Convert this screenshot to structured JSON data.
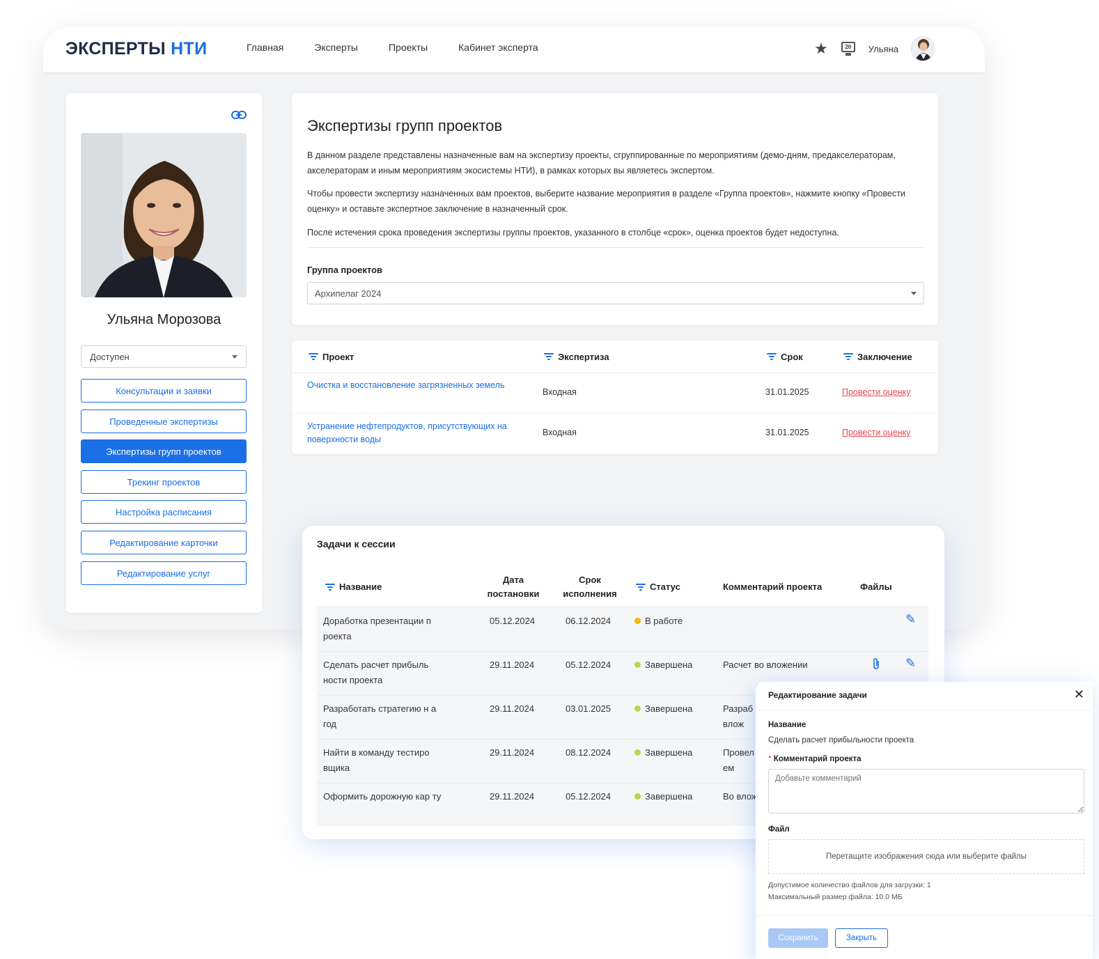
{
  "header": {
    "logo_part1": "ЭКСПЕРТЫ",
    "logo_part2": "НТИ",
    "nav": [
      "Главная",
      "Эксперты",
      "Проекты",
      "Кабинет эксперта"
    ],
    "notification_count": "20",
    "user_name": "Ульяна"
  },
  "profile": {
    "name": "Ульяна Морозова",
    "status": "Доступен",
    "menu": [
      "Консультации и заявки",
      "Проведенные экспертизы",
      "Экспертизы групп проектов",
      "Трекинг проектов",
      "Настройка расписания",
      "Редактирование карточки",
      "Редактирование услуг"
    ],
    "active_menu_index": 2
  },
  "info": {
    "title": "Экспертизы групп проектов",
    "p1": "В данном разделе представлены назначенные вам на экспертизу проекты, сгруппированные по мероприятиям (демо-дням, предакселераторам, акселераторам и иным мероприятиям экосистемы НТИ), в рамках которых вы являетесь экспертом.",
    "p2": "Чтобы провести экспертизу назначенных вам проектов, выберите название мероприятия в разделе «Группа проектов», нажмите кнопку «Провести оценку» и оставьте экспертное заключение в назначенный срок.",
    "p3": "После истечения срока проведения экспертизы группы проектов, указанного в столбце «срок», оценка проектов будет недоступна.",
    "group_label": "Группа проектов",
    "group_value": "Архипелаг 2024"
  },
  "projects": {
    "headers": [
      "Проект",
      "Экспертиза",
      "Срок",
      "Заключение"
    ],
    "rows": [
      {
        "project": "Очистка и восстановление загрязненных земель",
        "expertise": "Входная",
        "deadline": "31.01.2025",
        "action": "Провести оценку"
      },
      {
        "project": "Устранение нефтепродуктов, присутствующих на поверхности воды",
        "expertise": "Входная",
        "deadline": "31.01.2025",
        "action": "Провести оценку"
      }
    ]
  },
  "tasks": {
    "title": "Задачи к сессии",
    "headers": {
      "name": "Название",
      "date_line1": "Дата",
      "date_line2": "постановки",
      "due_line1": "Срок",
      "due_line2": "исполнения",
      "status": "Статус",
      "comment": "Комментарий проекта",
      "files": "Файлы"
    },
    "rows": [
      {
        "name": "Доработка презентации п роекта",
        "date": "05.12.2024",
        "due": "06.12.2024",
        "status": "В работе",
        "status_color": "#f5b800",
        "comment": ""
      },
      {
        "name": "Сделать расчет прибыль ности проекта",
        "date": "29.11.2024",
        "due": "05.12.2024",
        "status": "Завершена",
        "status_color": "#b6d94c",
        "comment": "Расчет во вложении"
      },
      {
        "name": "Разработать стратегию н а год",
        "date": "29.11.2024",
        "due": "03.01.2025",
        "status": "Завершена",
        "status_color": "#b6d94c",
        "comment": "Разраб о влож"
      },
      {
        "name": "Найти в команду тестиро вщика",
        "date": "29.11.2024",
        "due": "08.12.2024",
        "status": "Завершена",
        "status_color": "#b6d94c",
        "comment": "Провел ем"
      },
      {
        "name": "Оформить дорожную кар ту",
        "date": "29.11.2024",
        "due": "05.12.2024",
        "status": "Завершена",
        "status_color": "#b6d94c",
        "comment": "Во влож"
      }
    ]
  },
  "modal": {
    "title": "Редактирование задачи",
    "name_label": "Название",
    "name_value": "Сделать расчет прибыльности проекта",
    "required_mark": "*",
    "comment_label": "Комментарий проекта",
    "comment_placeholder": "Добавьте комментарий",
    "file_label": "Файл",
    "drop_text": "Перетащите изображения сюда или выберите файлы",
    "note1": "Допустимое количество файлов для загрузки: 1",
    "note2": "Максимальный размер файла: 10.0 МБ",
    "save": "Сохранить",
    "close": "Закрыть"
  },
  "colors": {
    "accent": "#1a6fe6",
    "link_red": "#e5484d",
    "status_in_progress": "#f5b800",
    "status_done": "#b6d94c"
  }
}
